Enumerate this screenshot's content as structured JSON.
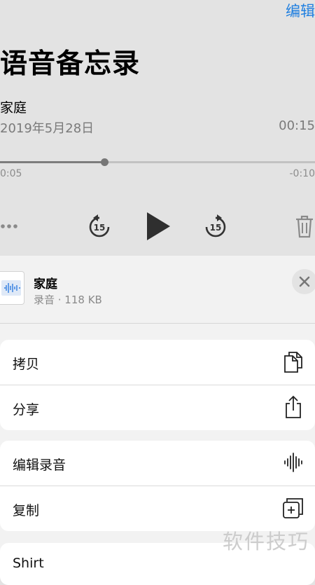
{
  "header": {
    "edit_label": "编辑",
    "title": "语音备忘录"
  },
  "recording": {
    "name": "家庭",
    "date": "2019年5月28日",
    "duration": "00:15",
    "elapsed": "0:05",
    "remaining": "-0:10",
    "progress": 0.33,
    "skip_seconds": "15"
  },
  "sheet": {
    "file_name": "家庭",
    "file_meta": "录音 · 118 KB",
    "actions": [
      {
        "label": "拷贝",
        "icon": "copy-icon"
      },
      {
        "label": "分享",
        "icon": "share-icon"
      },
      {
        "label": "编辑录音",
        "icon": "waveform-icon"
      },
      {
        "label": "复制",
        "icon": "duplicate-icon"
      },
      {
        "label": "Shirt",
        "icon": ""
      }
    ]
  },
  "watermark": "软件技巧",
  "colors": {
    "accent": "#1f7fe0",
    "sheet_bg": "#f2f2f2",
    "dim_bg": "#e3e3e3"
  }
}
